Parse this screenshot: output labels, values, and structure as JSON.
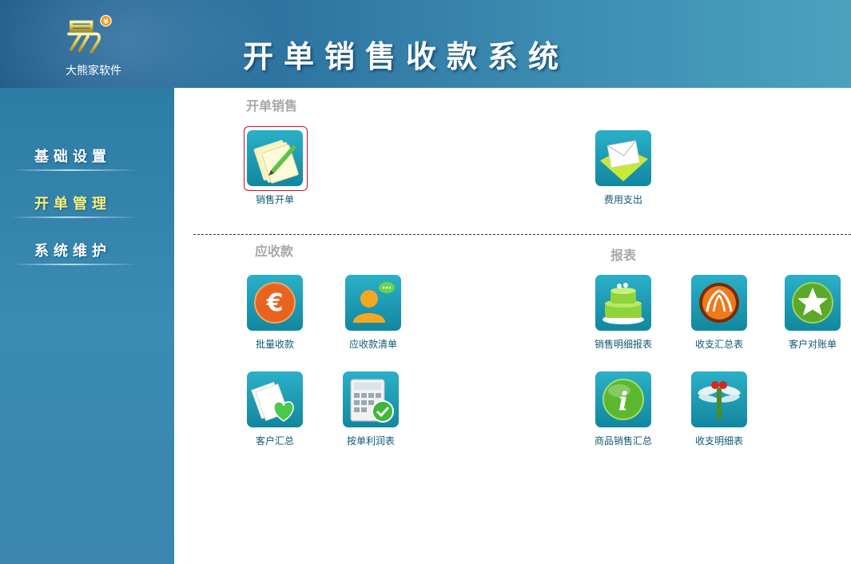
{
  "header": {
    "logo_text": "大熊家软件",
    "app_title": "开单销售收款系统"
  },
  "sidebar": {
    "items": [
      {
        "label": "基础设置",
        "active": false
      },
      {
        "label": "开单管理",
        "active": true
      },
      {
        "label": "系统维护",
        "active": false
      }
    ]
  },
  "sections": {
    "sales": {
      "title": "开单销售",
      "tiles": [
        {
          "label": "销售开单",
          "icon": "notepad-pencil-icon",
          "selected": true
        },
        {
          "label": "费用支出",
          "icon": "envelope-icon"
        }
      ]
    },
    "receivables": {
      "title": "应收款",
      "tiles": [
        {
          "label": "批量收款",
          "icon": "euro-coin-icon"
        },
        {
          "label": "应收款清单",
          "icon": "user-chat-icon"
        },
        {
          "label": "客户汇总",
          "icon": "documents-heart-icon"
        },
        {
          "label": "按单利润表",
          "icon": "calculator-check-icon"
        }
      ]
    },
    "reports": {
      "title": "报表",
      "tiles": [
        {
          "label": "销售明细报表",
          "icon": "cake-icon"
        },
        {
          "label": "收支汇总表",
          "icon": "orange-orb-icon"
        },
        {
          "label": "客户对账单",
          "icon": "green-star-icon"
        },
        {
          "label": "商品销售汇总",
          "icon": "info-icon"
        },
        {
          "label": "收支明细表",
          "icon": "dragonfly-icon"
        }
      ]
    }
  },
  "colors": {
    "header_start": "#1f5a86",
    "header_end": "#4aa2bd",
    "sidebar": "#3a86ae",
    "active_nav": "#f5f07a",
    "tile_bg": "#1a9bb4",
    "caption": "#0e5a74",
    "section_title": "#a8a8a8",
    "selection_border": "#c8102e"
  }
}
